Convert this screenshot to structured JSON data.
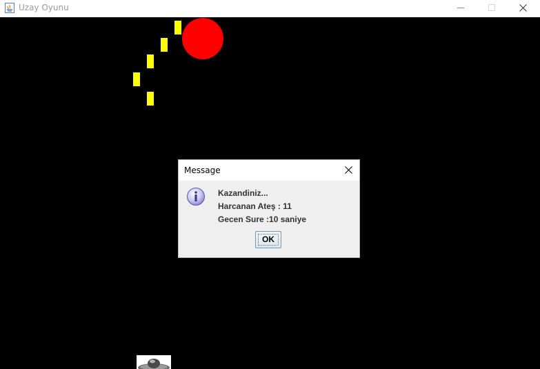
{
  "window": {
    "title": "Uzay Oyunu",
    "icon": "java-icon",
    "controls": [
      "minimize-icon",
      "maximize-icon",
      "close-icon"
    ]
  },
  "game": {
    "background_color": "#000000",
    "bullet_color": "#ffff00",
    "target_color": "#ff0000",
    "bullets_visible": 5
  },
  "dialog": {
    "title": "Message",
    "icon": "info-icon",
    "lines": [
      "Kazandiniz...",
      "Harcanan Ateş : 11",
      "Gecen Sure :10 saniye"
    ],
    "ok_label": "OK"
  }
}
